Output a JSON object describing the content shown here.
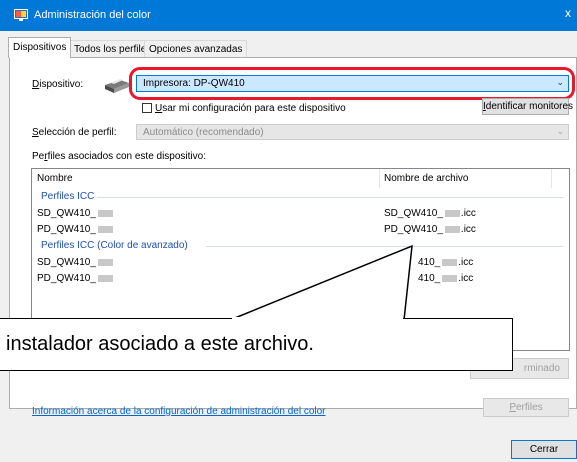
{
  "window": {
    "title": "Administración del color",
    "close_glyph": "x",
    "icon": "monitor-icon"
  },
  "tabs": [
    {
      "label": "Dispositivos",
      "active": true
    },
    {
      "label": "Todos los perfiles",
      "active": false
    },
    {
      "label": "Opciones avanzadas",
      "active": false
    }
  ],
  "device": {
    "label_accel": "D",
    "label_rest": "ispositivo:",
    "selected": "Impresora: DP-QW410",
    "icon": "printer-icon"
  },
  "use_my_settings": {
    "accel": "U",
    "rest": "sar mi configuración para este dispositivo",
    "checked": false
  },
  "identify_button": {
    "accel": "I",
    "rest": "dentificar monitores"
  },
  "profile_selection": {
    "label_accel": "S",
    "label_rest": "elección de perfil:",
    "value": "Automático (recomendado)"
  },
  "associated_label": {
    "pre": "Pe",
    "accel": "r",
    "rest": "files asociados con este dispositivo:"
  },
  "list": {
    "columns": [
      "Nombre",
      "Nombre de archivo"
    ],
    "groups": [
      {
        "title": "Perfiles ICC",
        "rows": [
          {
            "name": "SD_QW410_",
            "file_pre": "SD_QW410_",
            "file_post": ".icc"
          },
          {
            "name": "PD_QW410_",
            "file_pre": "PD_QW410_",
            "file_post": ".icc"
          }
        ]
      },
      {
        "title": "Perfiles ICC (Color de avanzado)",
        "rows": [
          {
            "name": "SD_QW410_",
            "file_pre": "410_",
            "file_post": ".icc"
          },
          {
            "name": "PD_QW410_",
            "file_pre": "410_",
            "file_post": ".icc"
          }
        ]
      }
    ]
  },
  "callout": {
    "text": "instalador asociado a este archivo."
  },
  "set_default_button": {
    "text": "rminado"
  },
  "info_link": "Información acerca de la configuración de administración del color",
  "profiles_button": {
    "accel": "P",
    "rest": "erfiles"
  },
  "close_button": "Cerrar",
  "colors": {
    "titlebar": "#0078d7",
    "highlight_ring": "#e8192c",
    "group_text": "#1e50b0",
    "link": "#0066cc"
  }
}
